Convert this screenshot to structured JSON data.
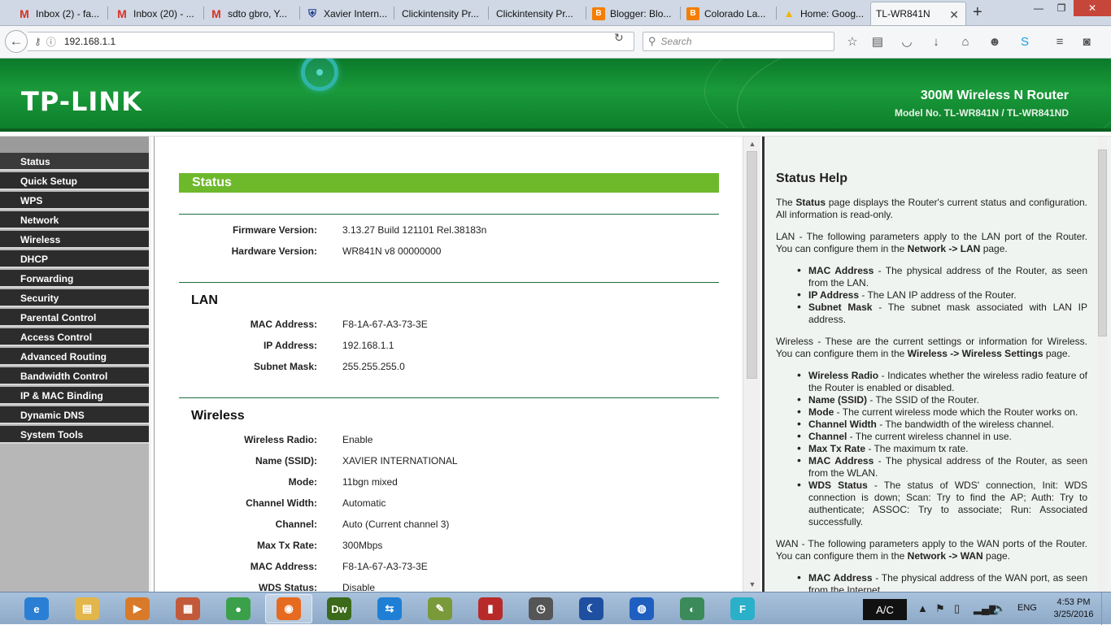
{
  "browser": {
    "tabs": [
      {
        "title": "Inbox (2) - fa...",
        "icon": "gmail-icon",
        "active": false
      },
      {
        "title": "Inbox (20) - ...",
        "icon": "gmail-icon",
        "active": false
      },
      {
        "title": "sdto gbro, Y...",
        "icon": "gmail-icon",
        "active": false
      },
      {
        "title": "Xavier Intern...",
        "icon": "shield-icon",
        "active": false
      },
      {
        "title": "Clickintensity Pr...",
        "icon": "page-icon",
        "active": false
      },
      {
        "title": "Clickintensity Pr...",
        "icon": "page-icon",
        "active": false
      },
      {
        "title": "Blogger: Blo...",
        "icon": "blogger-icon",
        "active": false
      },
      {
        "title": "Colorado La...",
        "icon": "blogger-icon",
        "active": false
      },
      {
        "title": "Home: Goog...",
        "icon": "drive-icon",
        "active": false
      },
      {
        "title": "TL-WR841N",
        "icon": "",
        "active": true
      }
    ],
    "new_tab": "+",
    "url": "192.168.1.1",
    "search_placeholder": "Search",
    "colors": {
      "tab_strip": "#cfd8e4",
      "active_tab": "#f5f6f7"
    }
  },
  "router": {
    "brand": "TP-LINK",
    "product_name": "300M Wireless N Router",
    "model_no": "Model No. TL-WR841N / TL-WR841ND",
    "colors": {
      "header_green": "#1a9a3a",
      "section_green": "#6eb82c",
      "menu_dark": "#2c2c2c"
    },
    "menu": [
      "Status",
      "Quick Setup",
      "WPS",
      "Network",
      "Wireless",
      "DHCP",
      "Forwarding",
      "Security",
      "Parental Control",
      "Access Control",
      "Advanced Routing",
      "Bandwidth Control",
      "IP & MAC Binding",
      "Dynamic DNS",
      "System Tools"
    ],
    "status": {
      "title": "Status",
      "firmware_label": "Firmware Version:",
      "firmware_value": "3.13.27 Build 121101 Rel.38183n",
      "hardware_label": "Hardware Version:",
      "hardware_value": "WR841N v8 00000000",
      "lan": {
        "title": "LAN",
        "rows": [
          {
            "label": "MAC Address:",
            "value": "F8-1A-67-A3-73-3E"
          },
          {
            "label": "IP Address:",
            "value": "192.168.1.1"
          },
          {
            "label": "Subnet Mask:",
            "value": "255.255.255.0"
          }
        ]
      },
      "wireless": {
        "title": "Wireless",
        "rows": [
          {
            "label": "Wireless Radio:",
            "value": "Enable"
          },
          {
            "label": "Name (SSID):",
            "value": "XAVIER INTERNATIONAL"
          },
          {
            "label": "Mode:",
            "value": "11bgn mixed"
          },
          {
            "label": "Channel Width:",
            "value": "Automatic"
          },
          {
            "label": "Channel:",
            "value": "Auto (Current channel 3)"
          },
          {
            "label": "Max Tx Rate:",
            "value": "300Mbps"
          },
          {
            "label": "MAC Address:",
            "value": "F8-1A-67-A3-73-3E"
          },
          {
            "label": "WDS Status:",
            "value": "Disable"
          }
        ]
      }
    },
    "help": {
      "title": "Status Help",
      "intro_pre": "The ",
      "intro_bold": "Status",
      "intro_post": " page displays the Router's current status and configuration. All information is read-only.",
      "lan_pre": "LAN - The following parameters apply to the LAN port of the Router. You can configure them in the ",
      "lan_bold": "Network -> LAN",
      "lan_post": " page.",
      "lan_items": [
        {
          "term": "MAC Address",
          "desc": " - The physical address of the Router, as seen from the LAN."
        },
        {
          "term": "IP Address",
          "desc": " - The LAN IP address of the Router."
        },
        {
          "term": "Subnet Mask",
          "desc": " - The subnet mask associated with LAN IP address."
        }
      ],
      "wl_pre": "Wireless - These are the current settings or information for Wireless. You can configure them in the ",
      "wl_bold": "Wireless -> Wireless Settings",
      "wl_post": " page.",
      "wl_items": [
        {
          "term": "Wireless Radio",
          "desc": " - Indicates whether the wireless radio feature of the Router is enabled or disabled."
        },
        {
          "term": "Name (SSID)",
          "desc": " - The SSID of the Router."
        },
        {
          "term": "Mode",
          "desc": " - The current wireless mode which the Router works on."
        },
        {
          "term": "Channel Width",
          "desc": " - The bandwidth of the wireless channel."
        },
        {
          "term": "Channel",
          "desc": " - The current wireless channel in use."
        },
        {
          "term": "Max Tx Rate",
          "desc": " - The maximum tx rate."
        },
        {
          "term": "MAC Address",
          "desc": " - The physical address of the Router, as seen from the WLAN."
        },
        {
          "term": "WDS Status",
          "desc": " - The status of WDS' connection, Init: WDS connection is down; Scan: Try to find the AP; Auth: Try to authenticate; ASSOC: Try to associate; Run: Associated successfully."
        }
      ],
      "wan_pre": "WAN - The following parameters apply to the WAN ports of the Router. You can configure them in the ",
      "wan_bold": "Network -> WAN",
      "wan_post": " page.",
      "wan_items": [
        {
          "term": "MAC Address",
          "desc": " - The physical address of the WAN port, as seen from the Internet."
        }
      ]
    }
  },
  "taskbar": {
    "apps": [
      {
        "name": "internet-explorer-icon",
        "glyph": "e",
        "color": "#2a7fd4"
      },
      {
        "name": "file-explorer-icon",
        "glyph": "▤",
        "color": "#e2b64a"
      },
      {
        "name": "media-center-icon",
        "glyph": "▶",
        "color": "#d97a2a"
      },
      {
        "name": "archive-icon",
        "glyph": "▦",
        "color": "#c25a3a"
      },
      {
        "name": "chrome-icon",
        "glyph": "●",
        "color": "#3aa14a"
      },
      {
        "name": "firefox-icon",
        "glyph": "◉",
        "color": "#e66a1f"
      },
      {
        "name": "dreamweaver-icon",
        "glyph": "Dw",
        "color": "#3a6a1a"
      },
      {
        "name": "teamviewer-icon",
        "glyph": "⇆",
        "color": "#1f7fd4"
      },
      {
        "name": "pen-tool-icon",
        "glyph": "✎",
        "color": "#7a9a3a"
      },
      {
        "name": "book-icon",
        "glyph": "▮",
        "color": "#b82a2a"
      },
      {
        "name": "stopwatch-icon",
        "glyph": "◷",
        "color": "#555555"
      },
      {
        "name": "moon-app-icon",
        "glyph": "☾",
        "color": "#1f4fa0"
      },
      {
        "name": "globe-app-icon",
        "glyph": "◍",
        "color": "#1f5fc0"
      },
      {
        "name": "shield-app-icon",
        "glyph": "◐",
        "color": "#3a8a5a"
      },
      {
        "name": "f-app-icon",
        "glyph": "F",
        "color": "#2ab0c8"
      }
    ],
    "ac_label": "A/C",
    "language": "ENG",
    "time": "4:53 PM",
    "date": "3/25/2016"
  }
}
